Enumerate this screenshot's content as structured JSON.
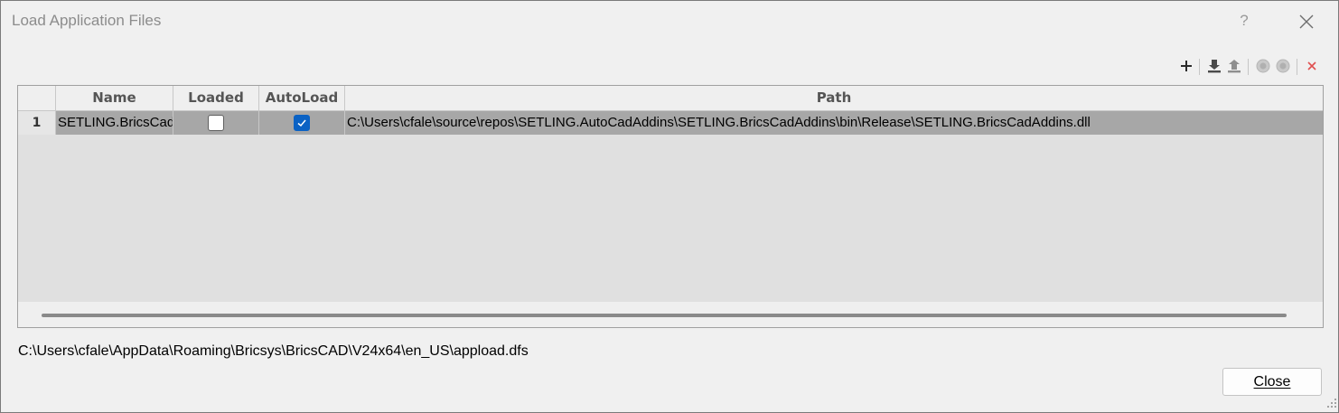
{
  "window": {
    "title": "Load Application Files",
    "help_label": "?"
  },
  "toolbar": {
    "icons": [
      "plus-icon",
      "download-icon",
      "upload-icon",
      "circle-icon",
      "circle-icon",
      "close-icon"
    ],
    "remove_color": "#e05050"
  },
  "grid": {
    "columns": [
      "",
      "Name",
      "Loaded",
      "AutoLoad",
      "Path"
    ],
    "rows": [
      {
        "index": "1",
        "name": "SETLING.BricsCadAddins",
        "loaded": false,
        "autoload": true,
        "path": "C:\\Users\\cfale\\source\\repos\\SETLING.AutoCadAddins\\SETLING.BricsCadAddins\\bin\\Release\\SETLING.BricsCadAddins.dll"
      }
    ]
  },
  "footer": {
    "dfs_path": "C:\\Users\\cfale\\AppData\\Roaming\\Bricsys\\BricsCAD\\V24x64\\en_US\\appload.dfs",
    "close_label": "Close"
  },
  "colors": {
    "accent": "#0b62c4",
    "selected_row": "#a7a7a7"
  }
}
